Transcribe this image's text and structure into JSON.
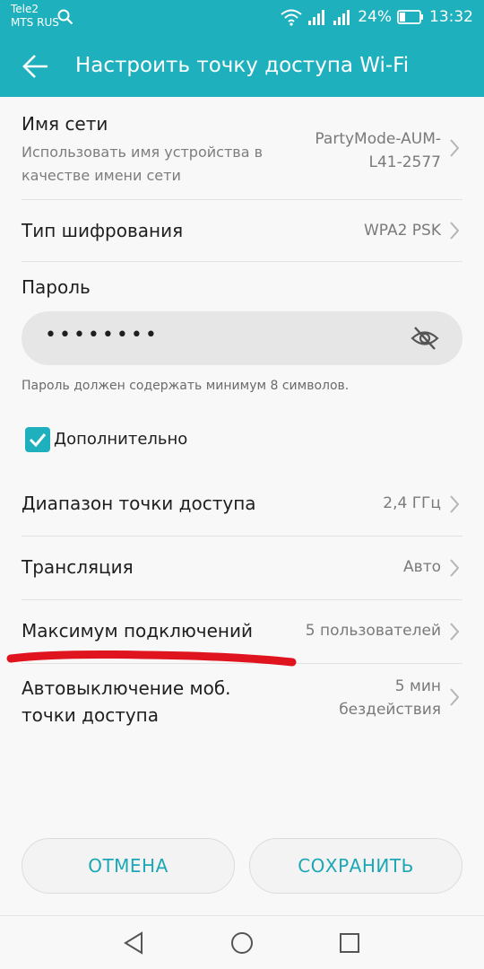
{
  "status_bar": {
    "carrier_1": "Tele2",
    "carrier_2": "MTS RUS",
    "battery": "24%",
    "time": "13:32"
  },
  "app_bar": {
    "title": "Настроить точку доступа Wi-Fi"
  },
  "settings": {
    "network_name": {
      "label": "Имя сети",
      "description": "Использовать имя устройства в качестве имени сети",
      "value_line1": "PartyMode-AUM-",
      "value_line2": "L41-2577"
    },
    "encryption": {
      "label": "Тип шифрования",
      "value": "WPA2 PSK"
    },
    "password": {
      "label": "Пароль",
      "value": "••••••••",
      "hint": "Пароль должен содержать минимум 8 символов."
    },
    "advanced": {
      "label": "Дополнительно",
      "checked": true
    },
    "band": {
      "label": "Диапазон точки доступа",
      "value": "2,4 ГГц"
    },
    "broadcast": {
      "label": "Трансляция",
      "value": "Авто"
    },
    "max_connections": {
      "label": "Максимум подключений",
      "value": "5 пользователей"
    },
    "auto_off": {
      "label_line1": "Автовыключение моб.",
      "label_line2": "точки доступа",
      "value_line1": "5 мин",
      "value_line2": "бездействия"
    }
  },
  "buttons": {
    "cancel": "ОТМЕНА",
    "save": "СОХРАНИТЬ"
  },
  "colors": {
    "accent": "#1fb0be",
    "annotation": "#e0141e"
  }
}
